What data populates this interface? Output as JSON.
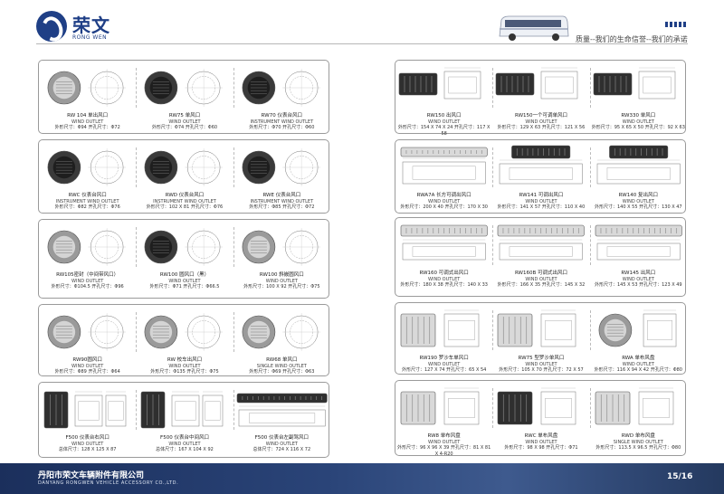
{
  "brand": {
    "name_cn": "荣文",
    "name_en": "RONG WEN"
  },
  "slogans": [
    "质量--我们的生命",
    "信誉--我们的承诺"
  ],
  "footer": {
    "company_cn": "丹阳市荣文车辆附件有限公司",
    "company_en": "DANYANG RONGWEN VEHICLE ACCESSORY CO.,LTD.",
    "page": "15/16"
  },
  "colors": {
    "brand": "#1f3f86",
    "footer": "#2a4478"
  },
  "left_rows": [
    [
      {
        "name": "RW 104 单出风口",
        "sub": "WIND OUTLET",
        "dims": "外形尺寸：Φ94  开孔尺寸：Φ72"
      },
      {
        "name": "RW75 单风口",
        "sub": "WIND OUTLET",
        "dims": "外形尺寸：Φ74  开孔尺寸：Φ60"
      },
      {
        "name": "RW70 仪表台风口",
        "sub": "INSTRUMENT WIND OUTLET",
        "dims": "外形尺寸：Φ70  开孔尺寸：Φ60"
      }
    ],
    [
      {
        "name": "RWC 仪表台风口",
        "sub": "INSTRUMENT WIND OUTLET",
        "dims": "外形尺寸：Φ82  开孔尺寸：Φ76"
      },
      {
        "name": "RWD 仪表台风口",
        "sub": "INSTRUMENT WIND OUTLET",
        "dims": "外形尺寸：102 X 81  开孔尺寸：Φ76"
      },
      {
        "name": "RWE 仪表台风口",
        "sub": "INSTRUMENT WIND OUTLET",
        "dims": "外形尺寸：Φ85  开孔尺寸：Φ72"
      }
    ],
    [
      {
        "name": "RW105密封（中间带风口）",
        "sub": "WIND OUTLET",
        "dims": "外形尺寸：Φ104.5  开孔尺寸：Φ96"
      },
      {
        "name": "RW100 圆风口（黑）",
        "sub": "WIND OUTLET",
        "dims": "外形尺寸：Φ71  开孔尺寸：Φ66.5"
      },
      {
        "name": "RW100 斜嵌圆风口",
        "sub": "WIND OUTLET",
        "dims": "外形尺寸：100 X 92  开孔尺寸：Φ75"
      }
    ],
    [
      {
        "name": "RW90圆风口",
        "sub": "WIND OUTLET",
        "dims": "外形尺寸：Φ89  开孔尺寸：Φ64"
      },
      {
        "name": "RW 校车出风口",
        "sub": "WIND OUTLET",
        "dims": "外形尺寸：Φ135  开孔尺寸：Φ75"
      },
      {
        "name": "RW68 单风口",
        "sub": "SINGLE WIND OUTLET",
        "dims": "外形尺寸：Φ69  开孔尺寸：Φ63"
      }
    ],
    [
      {
        "name": "F500 仪表台右风口",
        "sub": "WIND OUTLET",
        "dims": "总体尺寸：128 X 125 X 87"
      },
      {
        "name": "F500 仪表台中间风口",
        "sub": "WIND OUTLET",
        "dims": "总体尺寸：167 X 104 X 92"
      },
      {
        "name": "F500 仪表台左副驾风口",
        "sub": "WIND OUTLET",
        "dims": "总体尺寸：724 X 116 X 72"
      }
    ]
  ],
  "right_rows": [
    [
      {
        "name": "RW150 出风口",
        "sub": "WIND OUTLET",
        "dims": "外形尺寸：154 X 74 X 24  开孔尺寸：117 X 58"
      },
      {
        "name": "RW150一个可调单风口",
        "sub": "WIND OUTLET",
        "dims": "外形尺寸：129 X 63  开孔尺寸：121 X 56"
      },
      {
        "name": "RW330 单风口",
        "sub": "WIND OUTLET",
        "dims": "外形尺寸：95 X 65 X 50  开孔尺寸：92 X 63"
      }
    ],
    [
      {
        "name": "RWA7A 长方可调出风口",
        "sub": "WIND OUTLET",
        "dims": "外形尺寸：200 X 40  开孔尺寸：170 X 30"
      },
      {
        "name": "RW141 可调出风口",
        "sub": "WIND OUTLET",
        "dims": "外形尺寸：141 X 57  开孔尺寸：110 X 40"
      },
      {
        "name": "RW140 复出风口",
        "sub": "WIND OUTLET",
        "dims": "外形尺寸：140 X 55  开孔尺寸：130 X 47"
      }
    ],
    [
      {
        "name": "RW160 可调式出风口",
        "sub": "WIND OUTLET",
        "dims": "外形尺寸：180 X 38  开孔尺寸：140 X 33"
      },
      {
        "name": "RW160B 可调式出风口",
        "sub": "WIND OUTLET",
        "dims": "外形尺寸：166 X 35  开孔尺寸：145 X 32"
      },
      {
        "name": "RW145 出风口",
        "sub": "WIND OUTLET",
        "dims": "外形尺寸：145 X 53  开孔尺寸：123 X 49"
      }
    ],
    [
      {
        "name": "RW190 罗沙车单风口",
        "sub": "WIND OUTLET",
        "dims": "外形尺寸：127 X 74  开孔尺寸：65 X 54"
      },
      {
        "name": "RW75 型罗沙单风口",
        "sub": "WIND OUTLET",
        "dims": "外形尺寸：105 X 70  开孔尺寸：72 X 57"
      },
      {
        "name": "RWA 单布风盘",
        "sub": "WIND OUTLET",
        "dims": "外形尺寸：116 X 94 X 42  开孔尺寸：Φ80"
      }
    ],
    [
      {
        "name": "RW8 单布风盘",
        "sub": "WIND OUTLET",
        "dims": "外形尺寸：96 X 96 X 39  开孔尺寸：81 X 81 X 4-R20"
      },
      {
        "name": "RWC 单布风盘",
        "sub": "WIND OUTLET",
        "dims": "外形尺寸：98 X 98  开孔尺寸：Φ71"
      },
      {
        "name": "RWD 单布风盘",
        "sub": "SINGLE WIND OUTLET",
        "dims": "外形尺寸：113.5 X 96.5  开孔尺寸：Φ80"
      }
    ]
  ]
}
